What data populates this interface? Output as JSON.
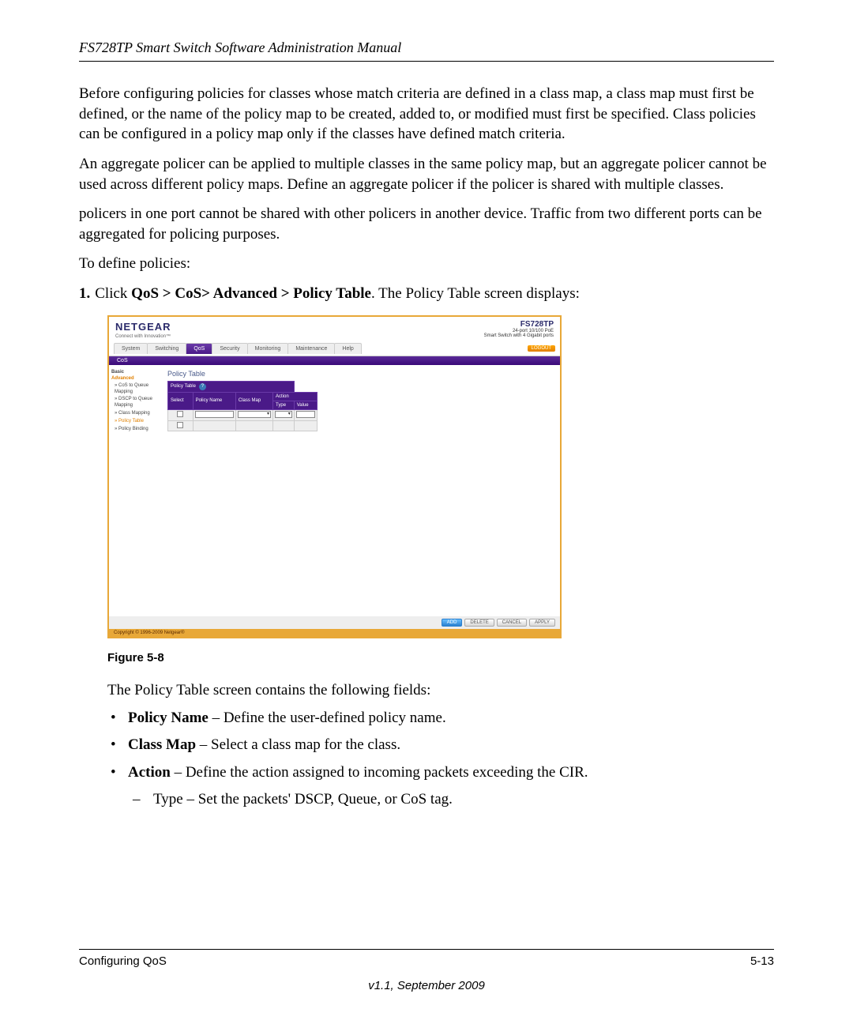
{
  "header": {
    "title": "FS728TP Smart Switch Software Administration Manual"
  },
  "paragraphs": {
    "p1": "Before configuring policies for classes whose match criteria are defined in a class map, a class map must first be defined, or the name of the policy map to be created, added to, or modified must first be specified. Class policies can be configured in a policy map only if the classes have defined match criteria.",
    "p2": "An aggregate policer can be applied to multiple classes in the same policy map, but an aggregate policer cannot be used across different policy maps. Define an aggregate policer if the policer is shared with multiple classes.",
    "p3": "policers in one port cannot be shared with other policers in another device. Traffic from two different ports can be aggregated for policing purposes.",
    "p4": "To define policies:"
  },
  "step1": {
    "num": "1.",
    "prefix": "Click ",
    "bold": "QoS > CoS> Advanced > Policy Table",
    "suffix": ". The Policy Table screen displays:"
  },
  "figure": {
    "logo": "NETGEAR",
    "logo_sub": "Connect with Innovation™",
    "model": "FS728TP",
    "model_sub1": "24-port 10/100 PoE",
    "model_sub2": "Smart Switch with 4 Gigabit ports",
    "logout": "LOGOUT",
    "nav": [
      "System",
      "Switching",
      "QoS",
      "Security",
      "Monitoring",
      "Maintenance",
      "Help"
    ],
    "subnav": "CoS",
    "side": {
      "basic": "Basic",
      "advanced": "Advanced",
      "items": [
        "CoS to Queue Mapping",
        "DSCP to Queue Mapping",
        "Class Mapping",
        "Policy Table",
        "Policy Binding"
      ]
    },
    "content_title": "Policy Table",
    "table": {
      "titlebar": "Policy Table",
      "h1": "Select",
      "h2": "Policy Name",
      "h3": "Class Map",
      "h4": "Action",
      "h4a": "Type",
      "h4b": "Value"
    },
    "buttons": {
      "add": "ADD",
      "delete": "DELETE",
      "cancel": "CANCEL",
      "apply": "APPLY"
    },
    "copyright": "Copyright © 1996-2009 Netgear®"
  },
  "figure_caption": "Figure 5-8",
  "fields_intro": "The Policy Table screen contains the following fields:",
  "bullets": {
    "b1_bold": "Policy Name",
    "b1_rest": " – Define the user-defined policy name.",
    "b2_bold": "Class Map",
    "b2_rest": " – Select a class map for the class.",
    "b3_bold": "Action",
    "b3_rest": " – Define the action assigned to incoming packets exceeding the CIR.",
    "b3_sub": "Type – Set the packets' DSCP, Queue, or CoS tag."
  },
  "footer": {
    "left": "Configuring QoS",
    "right": "5-13",
    "version": "v1.1, September 2009"
  }
}
